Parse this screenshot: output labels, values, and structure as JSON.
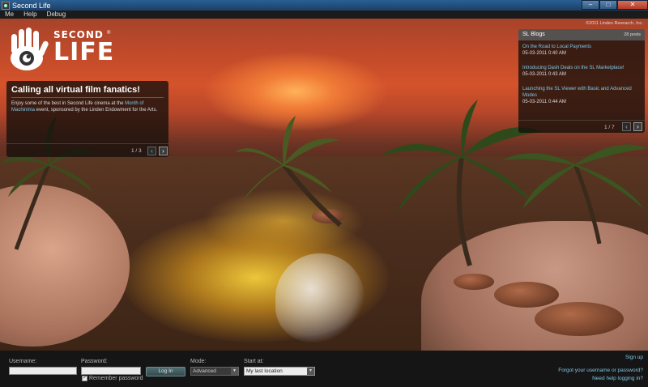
{
  "window": {
    "title": "Second Life",
    "controls": {
      "minimize": "–",
      "maximize": "□",
      "close": "✕"
    }
  },
  "menu": {
    "items": [
      "Me",
      "Help",
      "Debug"
    ]
  },
  "logo": {
    "top_word": "SECOND",
    "bottom_word": "LIFE",
    "trademark": "®",
    "icon": "hand-eye-logo"
  },
  "copyright": "©2011 Linden Research, Inc.",
  "promo": {
    "title": "Calling all virtual film fanatics!",
    "body_pre": "Enjoy some of the best in Second Life cinema at the ",
    "body_link": "Month of Machinima",
    "body_post": " event, sponsored by the Linden Endowment for the Arts.",
    "pager": "1 / 3",
    "prev": "‹",
    "next": "›"
  },
  "blogs": {
    "title": "SL Blogs",
    "count": "28 posts",
    "items": [
      {
        "title": "On the Road to Local Payments",
        "date": "05-03-2011 0:40 AM"
      },
      {
        "title": "Introducing Dash Deals on the SL Marketplace!",
        "date": "05-03-2011 0:43 AM"
      },
      {
        "title": "Launching the SL Viewer with Basic and Advanced Modes",
        "date": "05-03-2011 0:44 AM"
      }
    ],
    "pager": "1 / 7",
    "prev": "‹",
    "next": "›"
  },
  "login": {
    "username_label": "Username:",
    "username_value": "",
    "password_label": "Password:",
    "password_value": "",
    "login_button": "Log In",
    "remember_label": "Remember password",
    "remember_checked": true,
    "mode_label": "Mode:",
    "mode_value": "Advanced",
    "start_label": "Start at:",
    "start_value": "My last location",
    "signup": "Sign up",
    "forgot": "Forgot your username or password?",
    "help": "Need help logging in?"
  }
}
